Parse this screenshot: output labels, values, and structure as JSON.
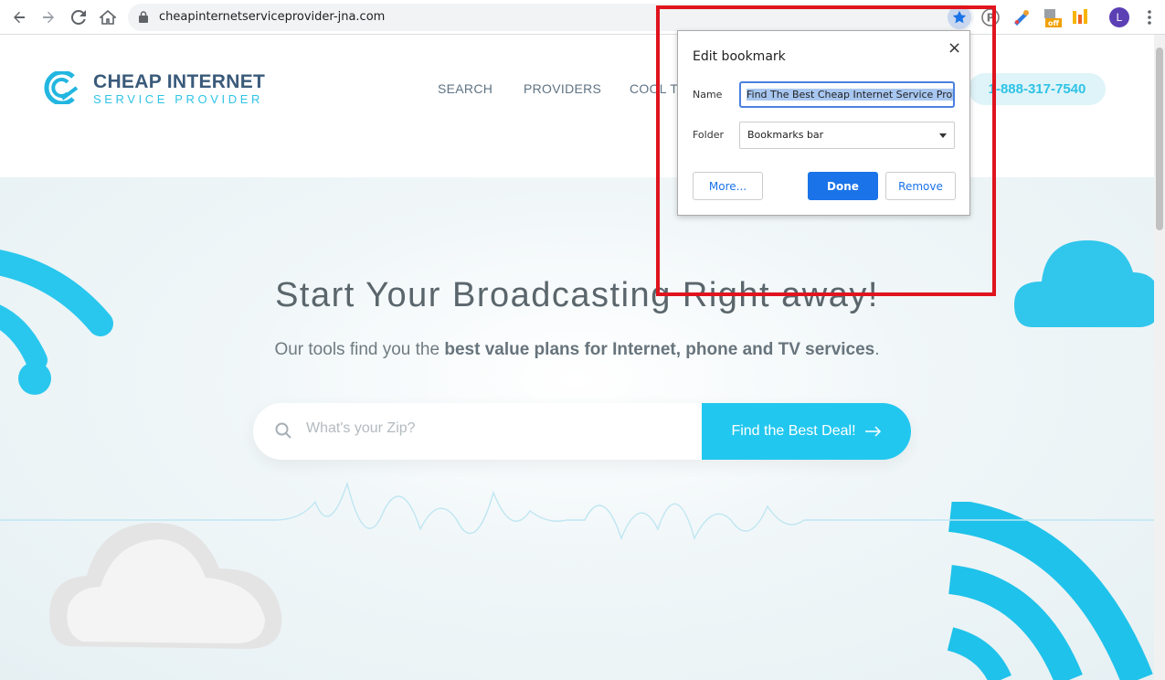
{
  "browser": {
    "url": "cheapinternetserviceprovider-jna.com",
    "avatar_letter": "L",
    "ext_badge": "off"
  },
  "site": {
    "logo_title": "CHEAP INTERNET",
    "logo_subtitle": "SERVICE PROVIDER",
    "nav": [
      {
        "label": "SEARCH"
      },
      {
        "label": "PROVIDERS"
      },
      {
        "label": "COOL TO"
      }
    ],
    "phone": "1-888-317-7540"
  },
  "hero": {
    "title": "Start Your Broadcasting Right away!",
    "subtitle_pre": "Our tools find you the ",
    "subtitle_bold": "best value plans for Internet, phone and TV services",
    "subtitle_post": ".",
    "zip_placeholder": "What's your Zip?",
    "deal_button": "Find the Best Deal!"
  },
  "bookmark_dialog": {
    "title": "Edit bookmark",
    "close": "×",
    "name_label": "Name",
    "name_value": "Find The Best Cheap Internet Service Provi",
    "folder_label": "Folder",
    "folder_value": "Bookmarks bar",
    "more_button": "More...",
    "done_button": "Done",
    "remove_button": "Remove"
  },
  "colors": {
    "accent": "#22c7ef",
    "brand_dark": "#3a5a7a",
    "chrome_blue": "#1a73e8",
    "highlight_red": "#e0141e"
  }
}
